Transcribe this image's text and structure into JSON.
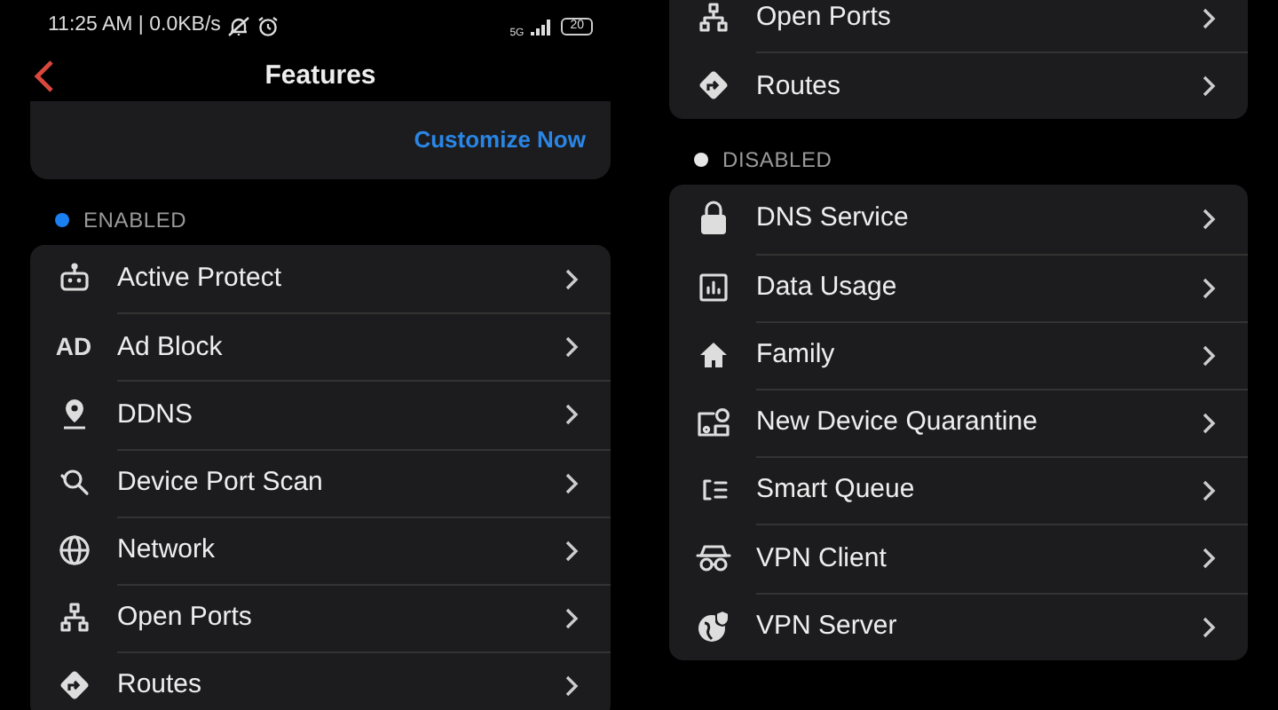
{
  "screens": [
    {
      "status_bar": {
        "time": "11:25 AM | 0.0KB/s",
        "network": "5G",
        "battery": "20"
      },
      "header": {
        "title": "Features"
      },
      "promo_card": {
        "link": "Customize Now"
      },
      "sections": [
        {
          "label": "ENABLED",
          "color": "#1a7ff0",
          "items": [
            {
              "kind": "robot",
              "label": "Active Protect"
            },
            {
              "kind": "text",
              "icon_text": "AD",
              "label": "Ad Block"
            },
            {
              "kind": "pin",
              "label": "DDNS"
            },
            {
              "kind": "search",
              "label": "Device Port Scan"
            },
            {
              "kind": "globe",
              "label": "Network"
            },
            {
              "kind": "network",
              "label": "Open Ports"
            },
            {
              "kind": "routes",
              "label": "Routes"
            }
          ]
        }
      ]
    },
    {
      "sections": [
        {
          "items": [
            {
              "kind": "network",
              "label": "Open Ports"
            },
            {
              "kind": "routes",
              "label": "Routes"
            }
          ]
        },
        {
          "label": "DISABLED",
          "color": "#e6e6e6",
          "items": [
            {
              "kind": "lock",
              "label": "DNS Service"
            },
            {
              "kind": "chart",
              "label": "Data Usage"
            },
            {
              "kind": "home",
              "label": "Family"
            },
            {
              "kind": "quarantine",
              "label": "New Device Quarantine"
            },
            {
              "kind": "queue",
              "label": "Smart Queue"
            },
            {
              "kind": "goggles",
              "label": "VPN Client"
            },
            {
              "kind": "globe-shield",
              "label": "VPN Server"
            }
          ]
        }
      ]
    }
  ]
}
